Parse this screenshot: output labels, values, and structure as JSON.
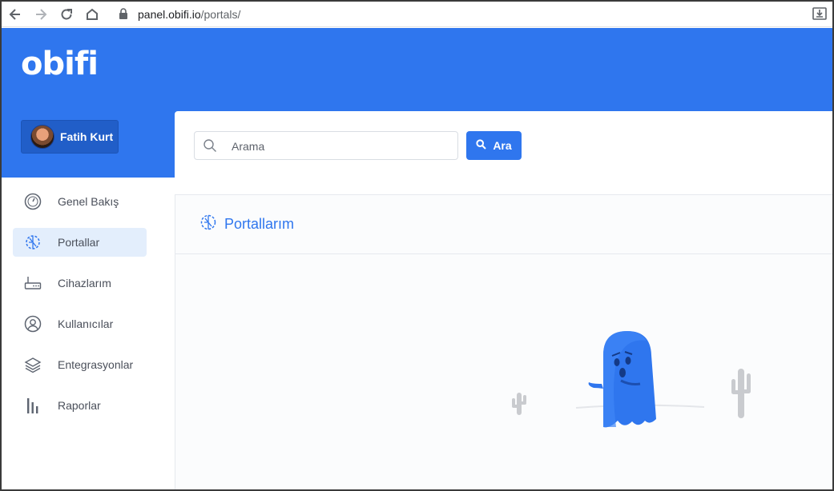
{
  "browser": {
    "url_host": "panel.obifi.io",
    "url_path": "/portals/"
  },
  "header": {
    "logo_text": "obifi",
    "user_name": "Fatih Kurt"
  },
  "sidebar": {
    "items": [
      {
        "label": "Genel Bakış",
        "icon": "gauge-icon",
        "active": false
      },
      {
        "label": "Portallar",
        "icon": "portal-icon",
        "active": true
      },
      {
        "label": "Cihazlarım",
        "icon": "router-icon",
        "active": false
      },
      {
        "label": "Kullanıcılar",
        "icon": "user-circle-icon",
        "active": false
      },
      {
        "label": "Entegrasyonlar",
        "icon": "layers-icon",
        "active": false
      },
      {
        "label": "Raporlar",
        "icon": "bar-chart-icon",
        "active": false
      }
    ]
  },
  "search": {
    "placeholder": "Arama",
    "button_label": "Ara"
  },
  "card": {
    "title": "Portallarım"
  },
  "colors": {
    "brand_blue": "#2f76ee",
    "user_chip": "#215ec8",
    "active_bg": "#e3eefc"
  }
}
